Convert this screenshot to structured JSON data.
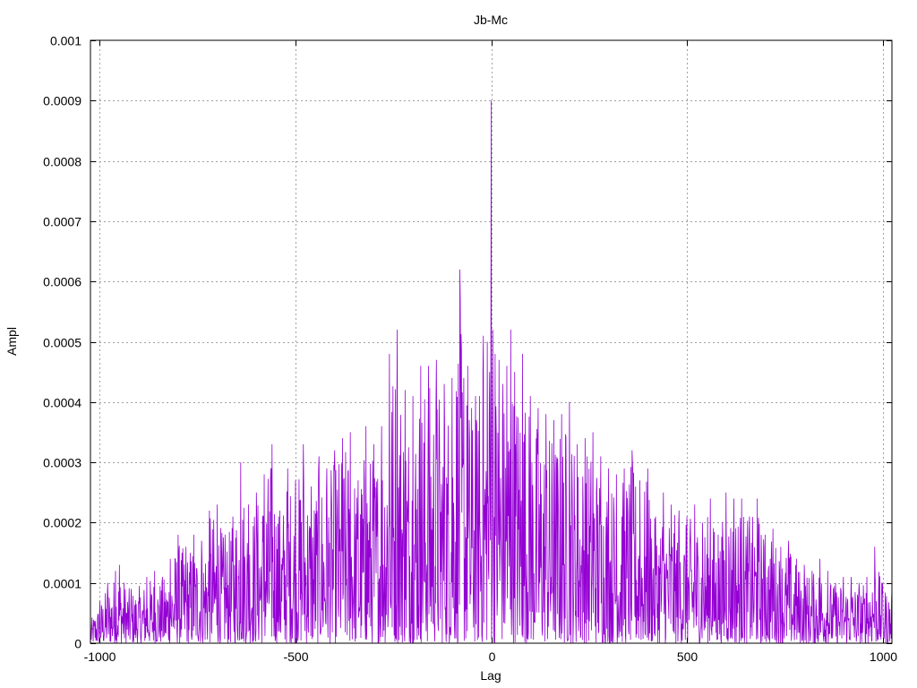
{
  "chart_data": {
    "type": "line",
    "title": "Jb-Mc",
    "xlabel": "Lag",
    "ylabel": "Ampl",
    "xlim": [
      -1024,
      1024
    ],
    "ylim": [
      0,
      0.001
    ],
    "xticks": [
      -1000,
      -500,
      0,
      500,
      1000
    ],
    "xtick_labels": [
      "-1000",
      "-500",
      "0",
      "500",
      "1000"
    ],
    "yticks": [
      0,
      0.0001,
      0.0002,
      0.0003,
      0.0004,
      0.0005,
      0.0006,
      0.0007,
      0.0008,
      0.0009,
      0.001
    ],
    "ytick_labels": [
      "0",
      "0.0001",
      "0.0002",
      "0.0003",
      "0.0004",
      "0.0005",
      "0.0006",
      "0.0007",
      "0.0008",
      "0.0009",
      "0.001"
    ],
    "grid": true,
    "line_color": "#9400d3",
    "series": [
      {
        "x": [
          -1024,
          -1000,
          -980,
          -960,
          -950,
          -920,
          -880,
          -860,
          -840,
          -820,
          -800,
          -780,
          -760,
          -740,
          -720,
          -700,
          -680,
          -660,
          -640,
          -620,
          -600,
          -580,
          -560,
          -540,
          -520,
          -500,
          -480,
          -460,
          -440,
          -420,
          -400,
          -380,
          -360,
          -340,
          -320,
          -300,
          -280,
          -260,
          -240,
          -220,
          -200,
          -180,
          -160,
          -140,
          -120,
          -100,
          -80,
          -70,
          -60,
          -50,
          -40,
          -30,
          -20,
          -10,
          -4,
          0,
          4,
          10,
          20,
          30,
          40,
          50,
          60,
          80,
          100,
          120,
          140,
          160,
          180,
          200,
          220,
          240,
          260,
          280,
          300,
          320,
          340,
          360,
          380,
          400,
          420,
          440,
          460,
          480,
          500,
          520,
          540,
          560,
          580,
          600,
          620,
          640,
          660,
          680,
          700,
          720,
          740,
          760,
          780,
          800,
          820,
          840,
          860,
          880,
          900,
          920,
          940,
          960,
          980,
          1000,
          1024
        ],
        "y": [
          4e-05,
          7e-05,
          0.0001,
          0.00012,
          0.00013,
          9e-05,
          0.00011,
          0.00012,
          0.00011,
          0.00014,
          0.00018,
          0.00016,
          0.00018,
          0.00017,
          0.00022,
          0.00023,
          0.00018,
          0.00021,
          0.0003,
          0.00023,
          0.00025,
          0.00028,
          0.00033,
          0.00022,
          0.00029,
          0.00027,
          0.00033,
          0.00026,
          0.00031,
          0.00029,
          0.00032,
          0.00034,
          0.00035,
          0.00027,
          0.00036,
          0.00033,
          0.00036,
          0.00048,
          0.00052,
          0.00042,
          0.00041,
          0.00046,
          0.00046,
          0.00047,
          0.00043,
          0.00044,
          0.00062,
          0.00044,
          0.00046,
          0.00039,
          0.00041,
          0.00041,
          0.00051,
          0.0005,
          0.00045,
          0.0009,
          0.00052,
          0.00048,
          0.00047,
          0.00043,
          0.00046,
          0.00052,
          0.00045,
          0.00048,
          0.00041,
          0.00039,
          0.00038,
          0.00037,
          0.00038,
          0.0004,
          0.00033,
          0.00034,
          0.00035,
          0.00031,
          0.00029,
          0.00028,
          0.00029,
          0.00032,
          0.00027,
          0.00029,
          0.00021,
          0.00025,
          0.00023,
          0.00022,
          0.00021,
          0.00023,
          0.0002,
          0.00024,
          0.00018,
          0.00025,
          0.00024,
          0.00024,
          0.00021,
          0.00024,
          0.00018,
          0.00019,
          0.00016,
          0.00017,
          0.00014,
          0.00013,
          0.00012,
          0.00014,
          0.00012,
          0.0001,
          0.00011,
          0.00011,
          0.0001,
          0.00011,
          0.00016,
          0.0001,
          9e-05
        ]
      }
    ]
  }
}
